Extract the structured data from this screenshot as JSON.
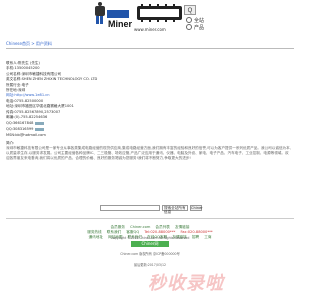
{
  "header": {
    "logo_text": "Miner",
    "site_url": "www.miner.com",
    "search_button": "Q",
    "radio_options": [
      "全站",
      "产品"
    ]
  },
  "breadcrumb": {
    "prefix": "Chinese首页 > 用户资料",
    "link": "Chinese首页"
  },
  "company": {
    "lines": [
      "联系人:陈先生 (先生)",
      "手机:13500045200",
      "公司名称:深圳市敏捷科技有限公司",
      "英文名称:SHEN ZHEN ZHIXIN TECHNOLOGY CO. LTD",
      "所属行业:电子",
      "所在地:深圳",
      "网址:http://www.1e81.cn",
      "电话:0755-82500000",
      "地址:深圳市福田区华强北路赛格大厦1001",
      "传真:0755-82567890,2573007",
      "邮编:(0)-755-82254636"
    ]
  },
  "qq": {
    "lines": [
      "QQ:366167848",
      "QQ:308316599",
      "MSN:bb@hotmail.com"
    ]
  },
  "about": {
    "title": "简介:",
    "text": "深圳市敏捷科技有限公司是一家专业从事各类集成电路经营的现货供应商,集成电路经营方面,我们拥有丰富的经验和良好的信誉,可以为客户提供一系列优质产品。我公司以诚信为本,以质量求生存,以服务求发展。公司主要经营各种品牌IC、二三极管、场效应管,产品广泛应用于通讯、仪器、电脑及外设、家电、电子产品、汽车电子、工业控制、电源等领域。欢迎各界朋友来电垂询,我们将以优质的产品、合理的价格、良好的服务竭诚为您服务!我们将不断努力,争取更大的进步!"
  },
  "bottom_search": {
    "input_value": "",
    "select_value": "搜索全站所有信息",
    "button_label": "Chiner"
  },
  "footer": {
    "line1": [
      "会员服务",
      "Chiner.com",
      "会员列表",
      "友情链接"
    ],
    "line2": [
      "服务热线",
      "联系我们",
      "客服QQ",
      "Tel:020-88000***",
      "Fax:020-88000***"
    ],
    "line3": [
      "通讯地址",
      "网站地图",
      "联系我们",
      "在线QQ客服",
      "友情链接",
      "招聘",
      "工商"
    ],
    "line4": "Copyright ©2016 Chiner.com All Rights Reserved",
    "badge": "Chiner网",
    "line5": "Chiner.com 版权所有 京ICP备000000号",
    "line6": "最后更新:2017/03/12"
  },
  "watermark": "秒收录啦"
}
